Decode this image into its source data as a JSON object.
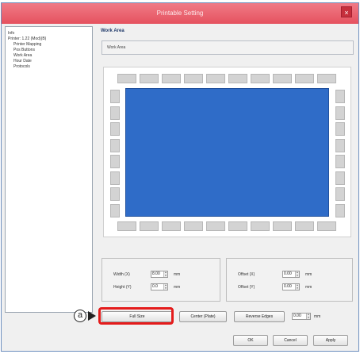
{
  "window": {
    "title": "Printable Setting",
    "close": "×"
  },
  "tree": {
    "root": "Info",
    "printer": "Printer: 1.22 (Mod)(B)",
    "items": [
      "Printer Mapping",
      "Pos Buttons",
      "Work Area",
      "Hour Date",
      "Protocols"
    ]
  },
  "panel": {
    "title": "Work Area",
    "tab": "Work Area"
  },
  "size_group": {
    "width_label": "Width (X)",
    "width_value": "8.00",
    "width_unit": "mm",
    "height_label": "Height (Y)",
    "height_value": "0.0",
    "height_unit": "mm"
  },
  "offset_group": {
    "offset_x_label": "Offset (X)",
    "offset_x_value": "0.00",
    "offset_x_unit": "mm",
    "offset_y_label": "Offset (Y)",
    "offset_y_value": "0.00",
    "offset_y_unit": "mm"
  },
  "buttons": {
    "full_size": "Full Size",
    "center": "Center (Plate)",
    "reverse": "Reverse Edges",
    "edge_value": "0.00",
    "edge_unit": "mm",
    "ok": "OK",
    "cancel": "Cancel",
    "apply": "Apply"
  },
  "annotation": {
    "callout": "a"
  },
  "colors": {
    "work_area": "#2f6cc8",
    "highlight": "#e41b1b",
    "titlebar": "#e5525f"
  }
}
